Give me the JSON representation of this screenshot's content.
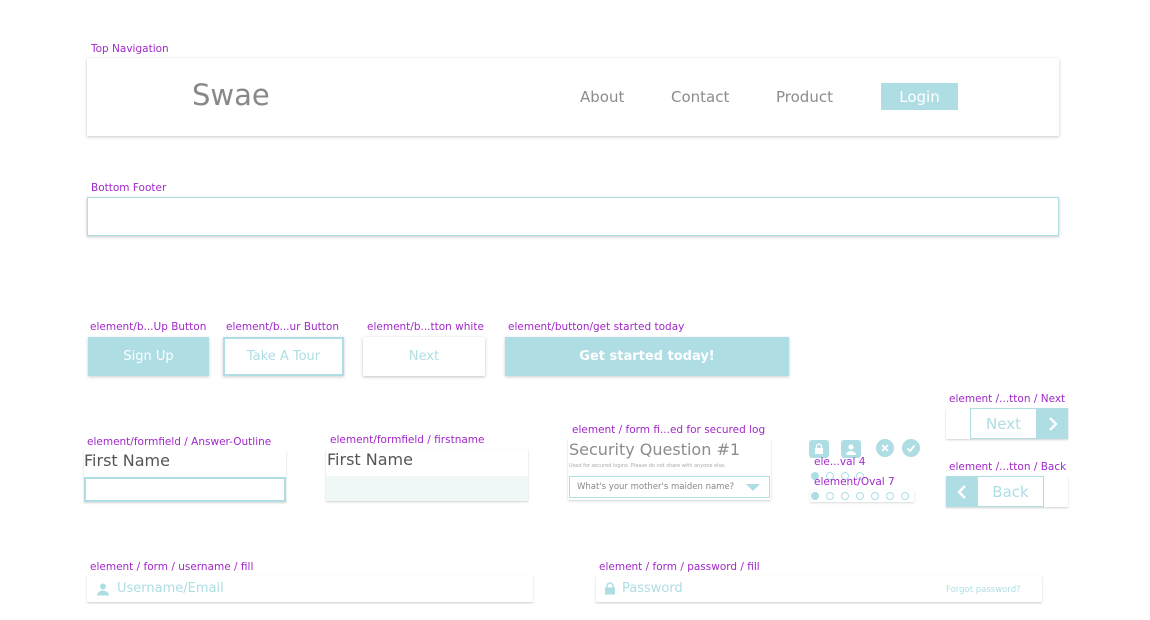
{
  "labels": {
    "top_nav": "Top Navigation",
    "bottom_footer": "Bottom Footer",
    "signup_btn": "element/b...Up Button",
    "tour_btn": "element/b...ur Button",
    "white_btn": "element/b...tton white",
    "get_started_btn": "element/button/get started today",
    "answer_outline": "element/formfield / Answer-Outline",
    "firstname_field": "element/formfield / firstname",
    "secured_log": "element / form fi...ed for secured log",
    "oval4": "ele...val 4",
    "oval7": "element/Oval 7",
    "next_nav": "element /...tton / Next",
    "back_nav": "element /...tton / Back",
    "username_fill": "element / form / username / fill",
    "password_fill": "element / form / password / fill"
  },
  "nav": {
    "brand": "Swae",
    "items": [
      "About",
      "Contact",
      "Product"
    ],
    "login": "Login"
  },
  "buttons": {
    "signup": "Sign Up",
    "tour": "Take A Tour",
    "next": "Next",
    "get_started": "Get started today!"
  },
  "forms": {
    "answer_title": "First Name",
    "answer_value": "",
    "firstname_title": "First Name",
    "security_title": "Security Question #1",
    "security_hint": "Used for secured logins. Please do not share with anyone else.",
    "security_select": "What's your mother's maiden name?",
    "username_placeholder": "Username/Email",
    "password_placeholder": "Password",
    "forgot": "Forgot password?"
  },
  "pager": {
    "next": "Next",
    "back": "Back"
  },
  "icons": {
    "lock": "lock-icon",
    "user": "user-icon",
    "close": "close-circle-icon",
    "check": "check-circle-icon",
    "chevron_right": "chevron-right-icon",
    "chevron_left": "chevron-left-icon",
    "dropdown": "chevron-down-icon"
  },
  "colors": {
    "accent": "#aedde4",
    "label": "#a128c9",
    "text": "#8c8c8c"
  }
}
